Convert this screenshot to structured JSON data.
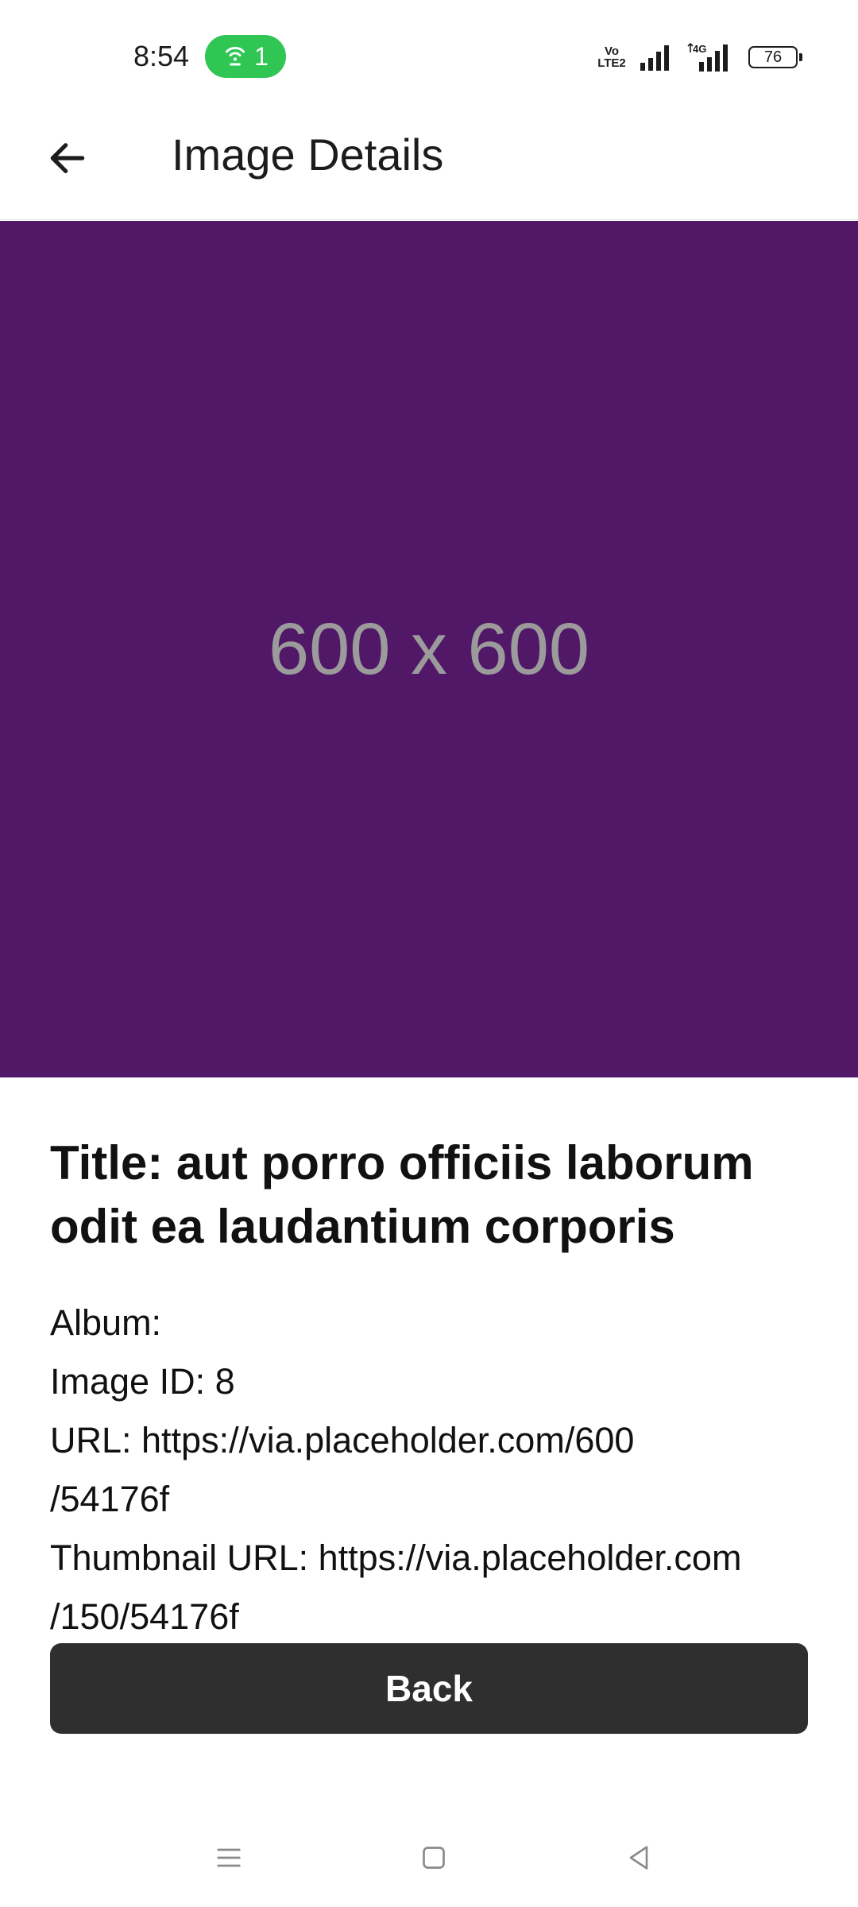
{
  "status_bar": {
    "time": "8:54",
    "hotspot_count": "1",
    "battery_level": "76",
    "volte_line1": "Vo",
    "volte_line2": "LTE2",
    "network_type": "4G",
    "hotspot_color": "#2fc653"
  },
  "app_bar": {
    "title": "Image Details",
    "back_icon": "arrow-left-icon"
  },
  "image": {
    "caption": "600 x 600",
    "background_color": "#521868"
  },
  "details": {
    "title": "Title: aut porro officiis laborum odit ea laudantium corporis",
    "album": "Album:",
    "image_id": "Image ID: 8",
    "url_line1": "URL: https://via.placeholder.com/600",
    "url_line2": "/54176f",
    "thumbnail_line1": "Thumbnail URL: https://via.placeholder.com",
    "thumbnail_line2": "/150/54176f"
  },
  "actions": {
    "back_label": "Back"
  },
  "nav_bar": {
    "icons": [
      "menu-icon",
      "home-square-icon",
      "back-triangle-icon"
    ]
  }
}
